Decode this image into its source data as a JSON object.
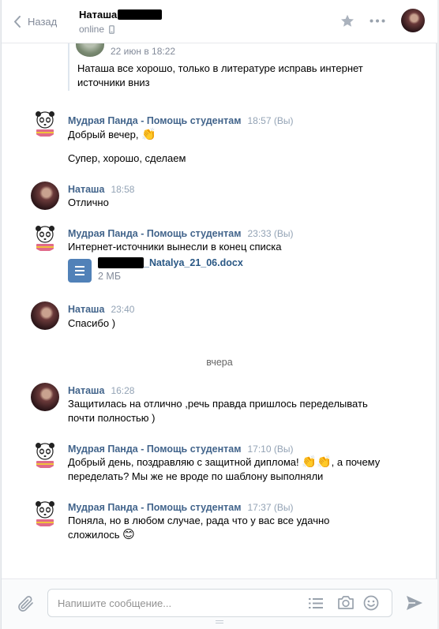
{
  "header": {
    "back_label": "Назад",
    "peer_name": "Наташа",
    "peer_status": "online"
  },
  "quote": {
    "time": "22 июн в 18:22",
    "text": "Наташа все хорошо, только в литературе исправь интернет источники вниз"
  },
  "messages": [
    {
      "name": "Мудрая Панда - Помощь студентам",
      "time": "18:57",
      "you": "(Вы)",
      "lines": [
        "Добрый вечер,",
        "Супер, хорошо, сделаем"
      ]
    },
    {
      "name": "Наташа",
      "time": "18:58",
      "lines": [
        "Отлично"
      ]
    },
    {
      "name": "Мудрая Панда - Помощь студентам",
      "time": "23:33",
      "you": "(Вы)",
      "lines": [
        "Интернет-источники вынесли в конец списка"
      ],
      "attachment": {
        "name": "_Natalya_21_06.docx",
        "size": "2 МБ"
      }
    },
    {
      "name": "Наташа",
      "time": "23:40",
      "lines": [
        "Спасибо )"
      ]
    },
    {
      "name": "Наташа",
      "time": "16:28",
      "lines": [
        "Защитилась на отлично ,речь правда пришлось переделывать почти полностью )"
      ]
    },
    {
      "name": "Мудрая Панда - Помощь студентам",
      "time": "17:10",
      "you": "(Вы)",
      "lines": [
        "Добрый день, поздравляю с защитной диплома!",
        ", а почему переделать? Мы же не вроде по шаблону выполняли"
      ]
    },
    {
      "name": "Мудрая Панда - Помощь студентам",
      "time": "17:37",
      "you": "(Вы)",
      "lines": [
        "Поняла, но в любом случае, рада что у вас все удачно сложилось"
      ]
    }
  ],
  "day_separator": "вчера",
  "composer": {
    "placeholder": "Напишите сообщение..."
  },
  "icons": {
    "back": "chevron-left-icon",
    "device": "phone-icon",
    "star": "star-icon",
    "more": "ellipsis-icon",
    "clap": "clapping-hands-emoji",
    "smile": "smiling-face-emoji",
    "doc": "document-icon",
    "clip": "paperclip-icon",
    "template": "list-icon",
    "camera": "camera-icon",
    "emoji": "smiley-icon",
    "send": "send-arrow-icon"
  },
  "colors": {
    "link": "#42648b",
    "accent": "#5181b8",
    "meta": "#828a99",
    "icon": "#aab2bd"
  }
}
